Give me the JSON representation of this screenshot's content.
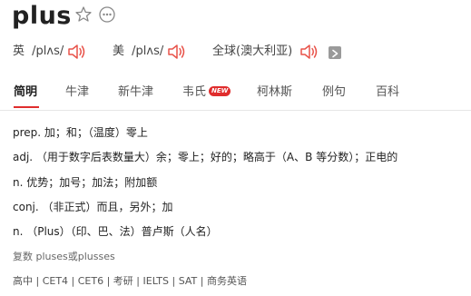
{
  "word": "plus",
  "icons": {
    "favorite": "star-outline-icon",
    "more": "more-dots-icon",
    "speaker": "speaker-icon",
    "play": "play-icon"
  },
  "pronunciations": [
    {
      "region": "英",
      "phonetic": "/plʌs/"
    },
    {
      "region": "美",
      "phonetic": "/plʌs/"
    },
    {
      "region": "全球(澳大利亚)",
      "phonetic": ""
    }
  ],
  "tabs": [
    {
      "label": "简明",
      "active": true
    },
    {
      "label": "牛津",
      "active": false
    },
    {
      "label": "新牛津",
      "active": false
    },
    {
      "label": "韦氏",
      "active": false,
      "badge": "NEW"
    },
    {
      "label": "柯林斯",
      "active": false
    },
    {
      "label": "例句",
      "active": false
    },
    {
      "label": "百科",
      "active": false
    }
  ],
  "definitions": [
    "prep. 加；和；（温度）零上",
    "adj. （用于数字后表数量大）余；零上；好的；略高于（A、B 等分数）；正电的",
    "n. 优势；加号；加法；附加额",
    "conj. （非正式）而且，另外；加",
    "n. （Plus）（印、巴、法）普卢斯（人名）"
  ],
  "plural": "复数 pluses或plusses",
  "exams": "高中 | CET4 | CET6 | 考研 | IELTS | SAT | 商务英语",
  "colors": {
    "accent": "#e02d2d",
    "text": "#222222",
    "speaker": "#e8534a"
  }
}
